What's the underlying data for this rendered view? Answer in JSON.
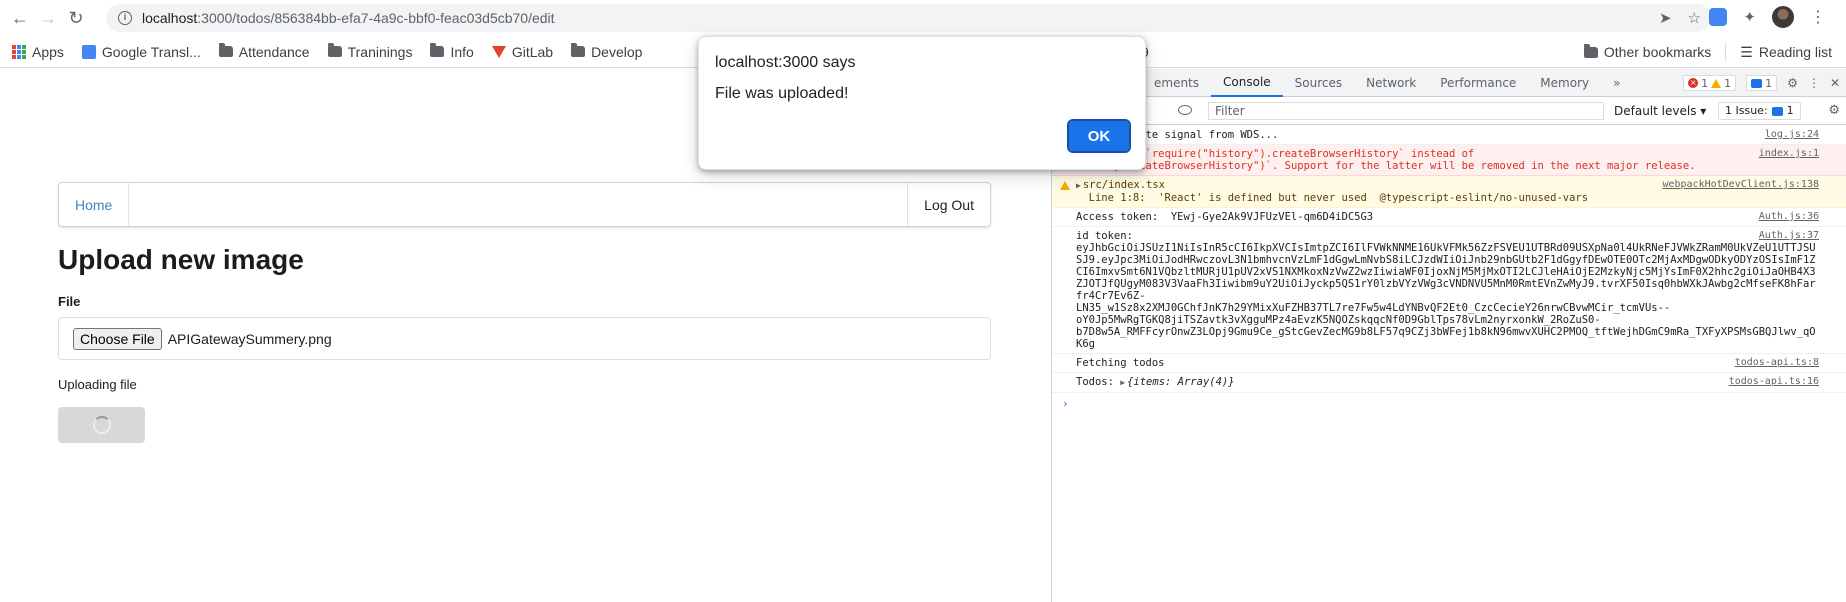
{
  "browser": {
    "url_host": "localhost",
    "url_path": ":3000/todos/856384bb-efa7-4a9c-bbf0-feac03d5cb70/edit",
    "bookmarks": [
      "Apps",
      "Google Transl...",
      "Attendance",
      "Traninings",
      "Info",
      "GitLab",
      "Develop"
    ],
    "bookmark_tail": "9",
    "other_bookmarks": "Other bookmarks",
    "reading_list": "Reading list"
  },
  "app": {
    "nav_home": "Home",
    "nav_logout": "Log Out",
    "title": "Upload new image",
    "file_label": "File",
    "choose_file": "Choose File",
    "file_name": "APIGatewaySummery.png",
    "uploading": "Uploading file"
  },
  "dialog": {
    "title": "localhost:3000 says",
    "message": "File was uploaded!",
    "ok": "OK"
  },
  "devtools": {
    "tabs": [
      "ements",
      "Console",
      "Sources",
      "Network",
      "Performance",
      "Memory",
      "»"
    ],
    "active_tab": "Console",
    "error_count": "1",
    "warn_count": "1",
    "msg_count": "1",
    "filter_placeholder": "Filter",
    "levels": "Default levels ▾",
    "issues": "1 Issue:",
    "issues_count": "1",
    "logs": [
      {
        "text": "ng for update signal from WDS...",
        "src": "log.js:24"
      },
      {
        "text": "Please use `require(\"history\").createBrowserHistory` instead of\n istory/createBrowserHistory\")`. Support for the latter will be removed in the next major release.",
        "src": "index.js:1"
      },
      {
        "text": "src/index.tsx\n  Line 1:8:  'React' is defined but never used  @typescript-eslint/no-unused-vars",
        "src": "webpackHotDevClient.js:138"
      },
      {
        "text": "Access token:  YEwj-Gye2Ak9VJFUzVEl-qm6D4iDC5G3",
        "src": "Auth.js:36"
      },
      {
        "text": "id token:\neyJhbGciOiJSUzI1NiIsInR5cCI6IkpXVCIsImtpZCI6IlFVWkNNME16UkVFMk56ZzFSVEU1UTBRd09USXpNa0l4UkRNeFJVWkZRamM0UkVZeU1UTTJSUSJ9.eyJpc3MiOiJodHRwczovL3N1bmhvcnVzLmF1dGgwLmNvbS8iLCJzdWIiOiJnb29nbGUtb2F1dGgyfDEwOTE0OTc2MjAxMDgwODkyODYzOSIsImF1ZCI6ImxvSmt6N1VQbzltMURjU1pUV2xVS1NXMkoxNzVwZ2wzIiwiaWF0IjoxNjM5MjMxOTI2LCJleHAiOjE2MzkyNjc5MjYsImF0X2hhc2giOiJaOHB4X3ZJOTJfQUgyM083V3VaaFh3Iiwibm9uY2UiOiJyckp5QS1rY0lzbVYzVWg3cVNDNVU5MnM0RmtEVnZwMyJ9.tvrXF50Isq0hbWXkJAwbg2cMfseFK8hFarfr4Cr7Ev6Z-\nLN35_w1Sz8x2XMJ0GChfJnK7h29YMixXuFZHB37TL7re7Fw5w4LdYNBvQF2Et0_CzcCecieY26nrwCBvwMCir_tcmVUs--\noY0Jp5MwRgTGKQ8jiTSZavtk3vXgguMPz4aEvzK5NQOZskqqcNf0D9GblTps78vLm2nyrxonkW_2RoZuS0-\nb7D8w5A_RMFFcyrOnwZ3LOpj9Gmu9Ce_gStcGevZecMG9b8LF57q9CZj3bWFej1b8kN96mwvXUHC2PMOQ_tftWejhDGmC9mRa_TXFyXPSMsGBQJlwv_qOK6g",
        "src": "Auth.js:37"
      },
      {
        "text": "Fetching todos",
        "src": "todos-api.ts:8"
      },
      {
        "text_prefix": "Todos: ",
        "text_obj": "{items: Array(4)}",
        "src": "todos-api.ts:16"
      }
    ]
  }
}
